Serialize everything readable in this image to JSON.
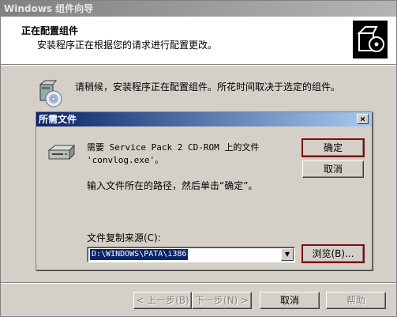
{
  "window": {
    "title": "Windows 组件向导",
    "header_title": "正在配置组件",
    "header_subtitle": "安装程序正在根据您的请求进行配置更改。",
    "info_text": "请稍候，安装程序正在配置组件。所花时间取决于选定的组件。"
  },
  "dialog": {
    "title": "所需文件",
    "close_label": "×",
    "message_line1": "需要 Service Pack 2 CD-ROM 上的文件",
    "message_line2": "'convlog.exe'。",
    "instruction": "输入文件所在的路径，然后单击“确定”。",
    "source_label": "文件复制来源(C):",
    "source_value": "D:\\WINDOWS\\PATA\\i386",
    "ok_label": "确定",
    "cancel_label": "取消",
    "browse_label": "浏览(B)..."
  },
  "footer": {
    "back_label": "< 上一步(B)",
    "next_label": "下一步(N) >",
    "cancel_label": "取消",
    "help_label": "帮助"
  },
  "icons": {
    "header_logo": "installer-box-cd-icon",
    "info": "installer-cd-icon",
    "dialog": "cd-rom-drive-icon",
    "combo_arrow": "chevron-down-icon"
  }
}
